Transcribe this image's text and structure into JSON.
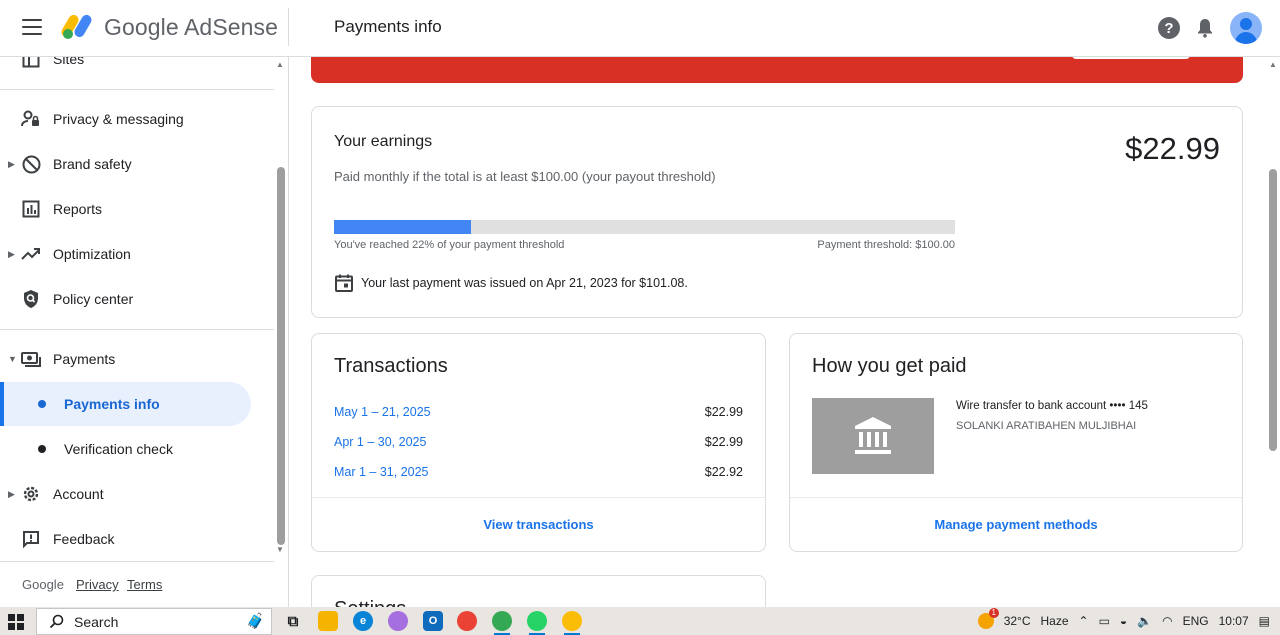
{
  "app": {
    "brand": "Google AdSense",
    "page_title": "Payments info"
  },
  "sidebar": {
    "items": [
      {
        "label": "Sites",
        "icon": "sites-icon"
      },
      {
        "label": "Privacy & messaging",
        "icon": "person-lock-icon"
      },
      {
        "label": "Brand safety",
        "icon": "block-icon"
      },
      {
        "label": "Reports",
        "icon": "bar-chart-icon"
      },
      {
        "label": "Optimization",
        "icon": "trending-up-icon"
      },
      {
        "label": "Policy center",
        "icon": "shield-search-icon"
      },
      {
        "label": "Payments",
        "icon": "payments-icon"
      },
      {
        "label": "Payments info"
      },
      {
        "label": "Verification check"
      },
      {
        "label": "Account",
        "icon": "gear-icon"
      },
      {
        "label": "Feedback",
        "icon": "feedback-icon"
      }
    ],
    "footer": {
      "brand": "Google",
      "privacy": "Privacy",
      "terms": "Terms"
    }
  },
  "earnings": {
    "title": "Your earnings",
    "subtitle": "Paid monthly if the total is at least $100.00 (your payout threshold)",
    "amount": "$22.99",
    "progress_fraction": 0.22,
    "progress_left": "You've reached 22% of your payment threshold",
    "progress_right": "Payment threshold: $100.00",
    "last_payment": "Your last payment was issued on Apr 21, 2023 for $101.08."
  },
  "transactions": {
    "title": "Transactions",
    "rows": [
      {
        "date": "May 1 – 21, 2025",
        "amount": "$22.99"
      },
      {
        "date": "Apr 1 – 30, 2025",
        "amount": "$22.99"
      },
      {
        "date": "Mar 1 – 31, 2025",
        "amount": "$22.92"
      }
    ],
    "link": "View transactions"
  },
  "how_paid": {
    "title": "How you get paid",
    "method": "Wire transfer to bank account •••• 145",
    "holder": "SOLANKI ARATIBAHEN MULJIBHAI",
    "link": "Manage payment methods"
  },
  "settings": {
    "title": "Settings"
  },
  "taskbar": {
    "search_placeholder": "Search",
    "weather": "32°C",
    "condition": "Haze",
    "language": "ENG",
    "time": "10:07"
  },
  "colors": {
    "accent": "#1a73e8",
    "progress": "#4285f4",
    "banner": "#d93025",
    "active_nav_bg": "#e8f0fe"
  }
}
